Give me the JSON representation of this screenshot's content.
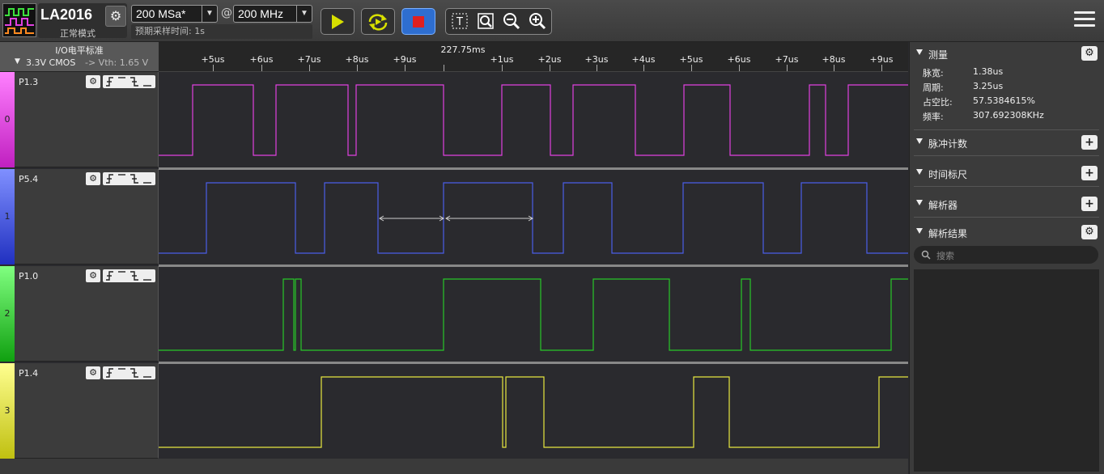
{
  "device": {
    "title": "LA2016",
    "mode": "正常模式"
  },
  "toolbar": {
    "sample_depth": "200 MSa*",
    "at": "@",
    "sample_rate": "200 MHz",
    "sample_time": "预期采样时间: 1s",
    "run_icon": "play-icon",
    "repeat_icon": "repeat-run-icon",
    "stop_icon": "stop-icon",
    "text_icon": "text-cursor-icon",
    "zoom_fit_icon": "zoom-fit-icon",
    "zoom_out_icon": "zoom-out-icon",
    "zoom_in_icon": "zoom-in-icon",
    "menu_icon": "hamburger-menu-icon"
  },
  "io_standard": {
    "title": "I/O电平标准",
    "value": "3.3V CMOS",
    "vth": "-> Vth: 1.65 V"
  },
  "ruler": {
    "center": "227.75ms",
    "ticks": [
      "+5us",
      "+6us",
      "+7us",
      "+8us",
      "+9us",
      "+1us",
      "+2us",
      "+3us",
      "+4us",
      "+5us",
      "+6us",
      "+7us",
      "+8us",
      "+9us"
    ]
  },
  "channels": [
    {
      "index": "0",
      "name": "P1.3",
      "color": "#e040e0"
    },
    {
      "index": "1",
      "name": "P5.4",
      "color": "#4a5ee8"
    },
    {
      "index": "2",
      "name": "P1.0",
      "color": "#28c828"
    },
    {
      "index": "3",
      "name": "P1.4",
      "color": "#e8e840"
    }
  ],
  "channel_buttons": {
    "rise": "⨍",
    "high": "‾",
    "fall": "Ɫ",
    "low": "_"
  },
  "right_panel": {
    "measure": {
      "title": "测量",
      "rows": [
        {
          "label": "脉宽:",
          "value": "1.38us"
        },
        {
          "label": "周期:",
          "value": "3.25us"
        },
        {
          "label": "占空比:",
          "value": "57.5384615%"
        },
        {
          "label": "频率:",
          "value": "307.692308KHz"
        }
      ]
    },
    "pulse_count": "脉冲计数",
    "time_ruler": "时间标尺",
    "decoder": "解析器",
    "decode_result": "解析结果",
    "search_placeholder": "搜索"
  }
}
